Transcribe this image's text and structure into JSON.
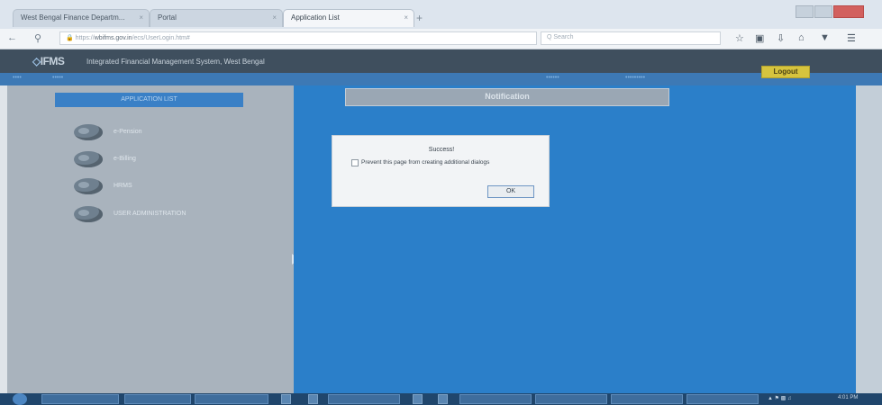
{
  "browser": {
    "tabs": [
      {
        "label": "West Bengal Finance Departm..."
      },
      {
        "label": "Portal"
      },
      {
        "label": "Application List",
        "active": true
      }
    ],
    "url_prefix": "https://",
    "url_domain": "wbifms.gov.in",
    "url_path": "/ecs/UserLogin.htm#",
    "search_placeholder": "Q Search"
  },
  "app": {
    "logo": "IFMS",
    "title": "Integrated Financial Management System, West Bengal",
    "logout_label": "Logout",
    "module_header": "APPLICATION LIST",
    "modules": [
      {
        "label": "e-Pension"
      },
      {
        "label": "e-Billing"
      },
      {
        "label": "HRMS"
      },
      {
        "label": "USER ADMINISTRATION"
      }
    ],
    "notification_title": "Notification"
  },
  "dialog": {
    "title": "Success!",
    "checkbox_label": "Prevent this page from creating additional dialogs",
    "ok_label": "OK"
  },
  "taskbar": {
    "clock": "4:01 PM"
  },
  "colors": {
    "app_header": "#3f4f5e",
    "nav_blue": "#3d79b5",
    "main_blue": "#2b7fc9",
    "logout_yellow": "#d6c43e",
    "left_panel": "#a9b3bd"
  }
}
